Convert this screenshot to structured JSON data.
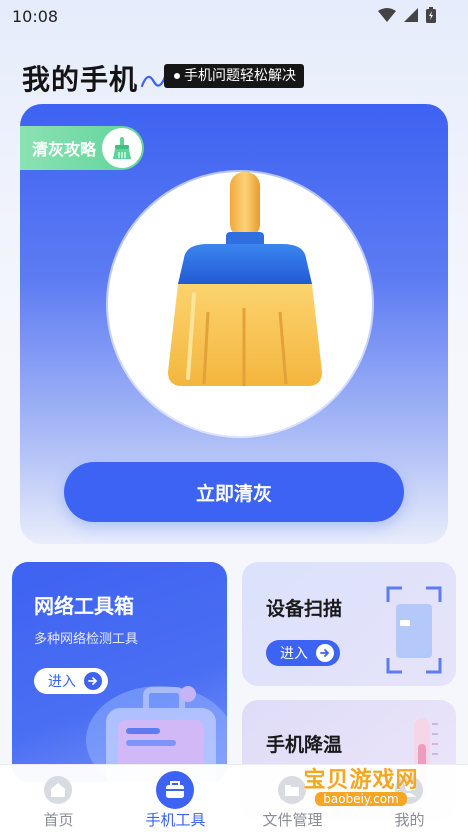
{
  "status_bar": {
    "time": "10:08",
    "icons": [
      "wifi-icon",
      "signal-icon",
      "battery-icon"
    ]
  },
  "header": {
    "title": "我的手机",
    "slogan": "手机问题轻松解决"
  },
  "hero": {
    "tip_tag": "清灰攻略",
    "tip_icon": "broom-icon",
    "main_image": "broom-illustration",
    "action_label": "立即清灰"
  },
  "tools": {
    "network": {
      "title": "网络工具箱",
      "desc": "多种网络检测工具",
      "enter_label": "进入"
    },
    "scan": {
      "title": "设备扫描",
      "enter_label": "进入"
    },
    "cool": {
      "title": "手机降温"
    }
  },
  "bottom_nav": {
    "items": [
      {
        "label": "首页",
        "icon": "home-icon"
      },
      {
        "label": "手机工具",
        "icon": "toolbox-icon"
      },
      {
        "label": "文件管理",
        "icon": "folder-icon"
      },
      {
        "label": "我的",
        "icon": "user-icon"
      }
    ],
    "active_index": 1
  },
  "watermark": {
    "main": "宝贝游戏网",
    "sub": "baobeiy.com"
  },
  "colors": {
    "accent": "#3c63f3",
    "tip_green": "#5fd49a",
    "broom_yellow": "#f7c347",
    "broom_blue": "#2f6fe0"
  }
}
